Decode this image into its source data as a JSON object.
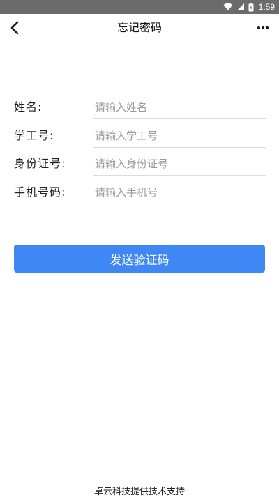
{
  "status_bar": {
    "time": "1:59",
    "icons": [
      "wifi-icon",
      "signal-icon",
      "battery-icon"
    ]
  },
  "header": {
    "title": "忘记密码",
    "back_icon": "chevron-left-icon",
    "more_icon": "more-horizontal-icon"
  },
  "form": {
    "fields": [
      {
        "label": "姓名:",
        "placeholder": "请输入姓名",
        "value": ""
      },
      {
        "label": "学工号:",
        "placeholder": "请输入学工号",
        "value": ""
      },
      {
        "label": "身份证号:",
        "placeholder": "请输入身份证号",
        "value": ""
      },
      {
        "label": "手机号码:",
        "placeholder": "请输入手机号",
        "value": ""
      }
    ]
  },
  "actions": {
    "send_code_label": "发送验证码"
  },
  "footer": {
    "text": "卓云科技提供技术支持"
  },
  "colors": {
    "status_bar": "#6b6b6b",
    "primary": "#3f87f5",
    "placeholder": "#9a9a9a",
    "divider": "#dcdcdc"
  }
}
